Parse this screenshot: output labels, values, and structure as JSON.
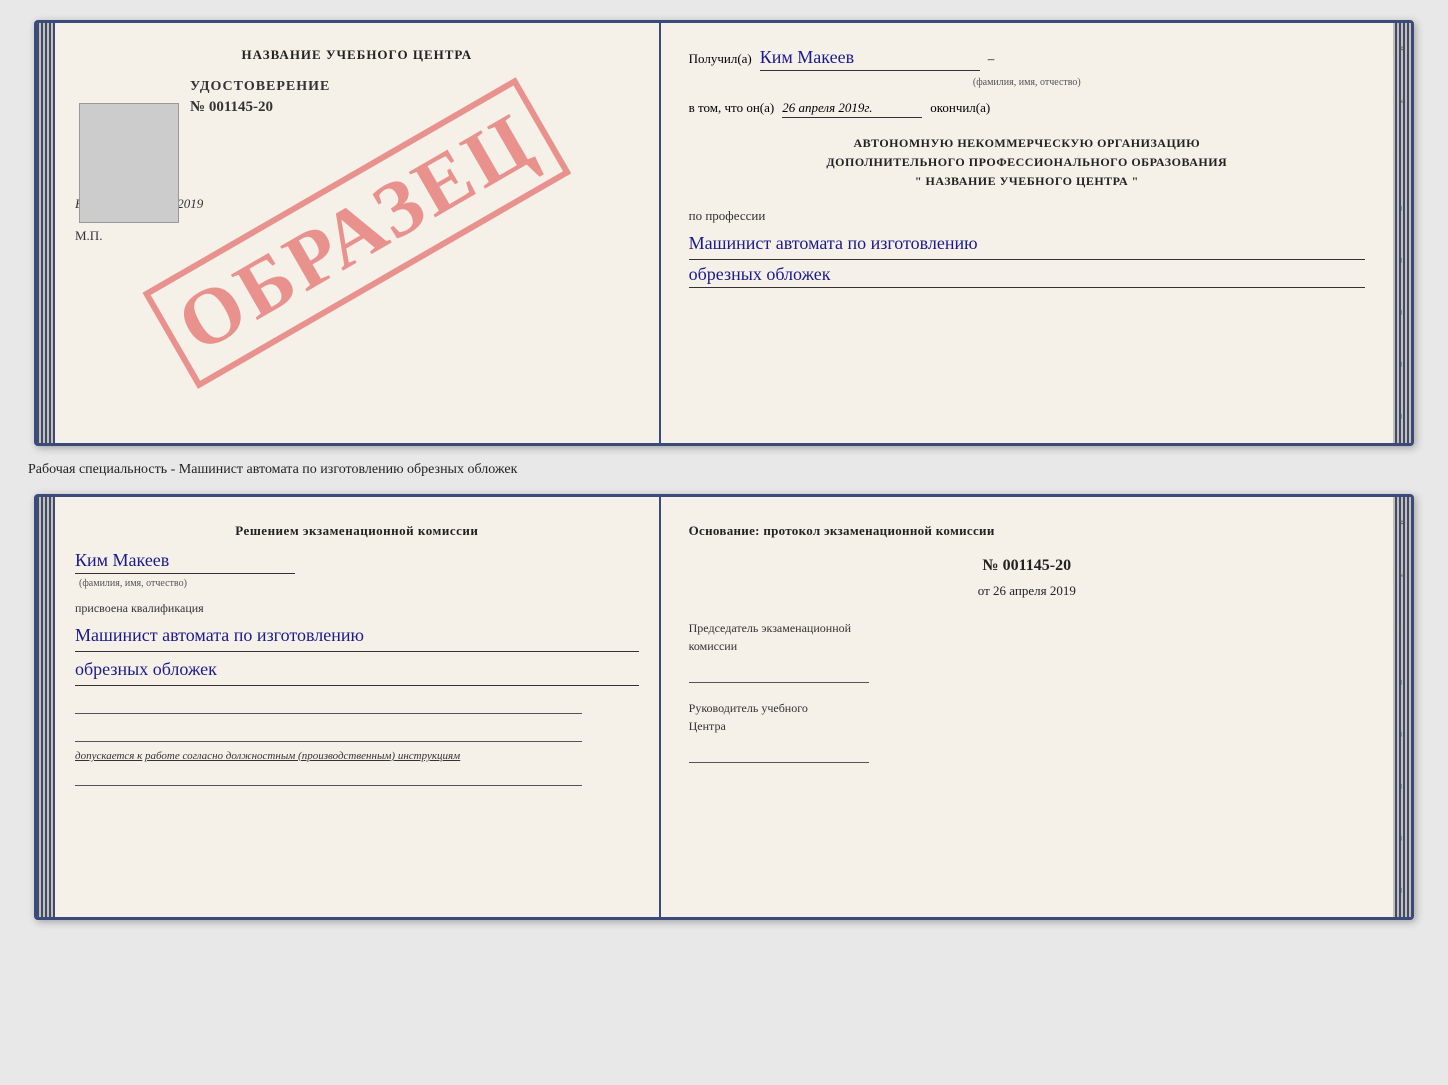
{
  "topCard": {
    "left": {
      "institutionTitle": "НАЗВАНИЕ УЧЕБНОГО ЦЕНТРА",
      "certTitle": "УДОСТОВЕРЕНИЕ",
      "certNumber": "№ 001145-20",
      "issuedLabel": "Выдано",
      "issuedDate": "26 апреля 2019",
      "mpLabel": "М.П.",
      "watermark": "ОБРАЗЕЦ"
    },
    "right": {
      "receivedLabel": "Получил(а)",
      "recipientName": "Ким Макеев",
      "subtitleFIO": "(фамилия, имя, отчество)",
      "inThatLabel": "в том, что он(а)",
      "completedDate": "26 апреля 2019г.",
      "completedLabel": "окончил(а)",
      "orgLine1": "АВТОНОМНУЮ НЕКОММЕРЧЕСКУЮ ОРГАНИЗАЦИЮ",
      "orgLine2": "ДОПОЛНИТЕЛЬНОГО ПРОФЕССИОНАЛЬНОГО ОБРАЗОВАНИЯ",
      "orgLine3": "\"   НАЗВАНИЕ УЧЕБНОГО ЦЕНТРА   \"",
      "professionLabel": "по профессии",
      "professionLine1": "Машинист автомата по изготовлению",
      "professionLine2": "обрезных обложек"
    }
  },
  "betweenText": "Рабочая специальность - Машинист автомата по изготовлению обрезных обложек",
  "bottomCard": {
    "left": {
      "commissionTitle1": "Решением экзаменационной комиссии",
      "personName": "Ким Макеев",
      "subtitleFIO": "(фамилия, имя, отчество)",
      "qualificationLabel": "присвоена квалификация",
      "qualLine1": "Машинист автомата по изготовлению",
      "qualLine2": "обрезных обложек",
      "допускLabel": "допускается к",
      "допускText": "работе согласно должностным (производственным) инструкциям"
    },
    "right": {
      "foundationLabel": "Основание: протокол экзаменационной комиссии",
      "protocolNumber": "№ 001145-20",
      "protocolDatePrefix": "от",
      "protocolDate": "26 апреля 2019",
      "chairmanLabel1": "Председатель экзаменационной",
      "chairmanLabel2": "комиссии",
      "headLabel1": "Руководитель учебного",
      "headLabel2": "Центра"
    }
  },
  "sideMarks": {
    "topRight": [
      "и",
      "а",
      "←",
      "–",
      "–",
      "–",
      "–",
      "–"
    ],
    "bottomRight": [
      "и",
      "а",
      "←",
      "–",
      "–",
      "–",
      "–",
      "–"
    ]
  }
}
